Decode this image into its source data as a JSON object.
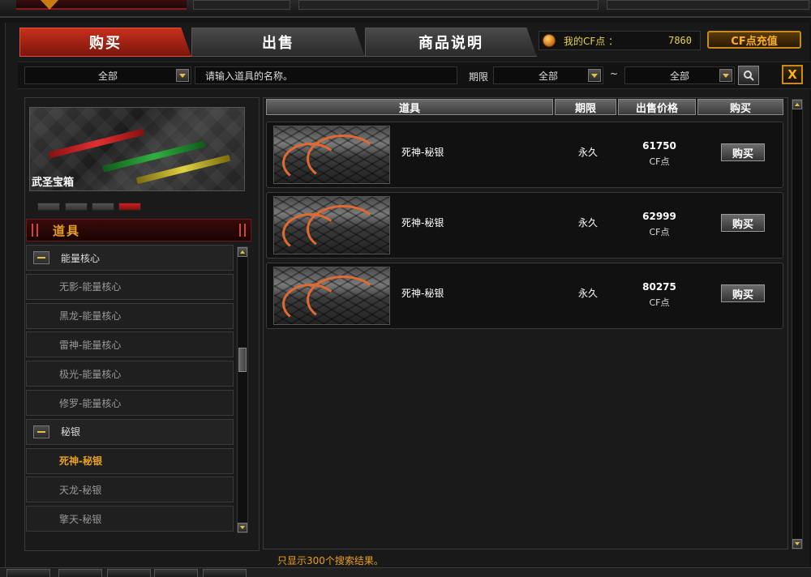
{
  "tabs": {
    "buy": "购买",
    "sell": "出售",
    "info": "商品说明"
  },
  "account": {
    "cf_label": "我的CF点 ：",
    "cf_value": "7860",
    "recharge_label": "CF点充值"
  },
  "filters": {
    "category_value": "全部",
    "search_placeholder": "请输入道具的名称。",
    "period_label": "期限",
    "period_from": "全部",
    "period_separator": "~",
    "period_to": "全部"
  },
  "close_label": "X",
  "banner": {
    "title": "武圣宝箱",
    "slide_count": 4,
    "active_slide": 4
  },
  "category": {
    "title": "道具",
    "items": [
      {
        "type": "group",
        "label": "能量核心"
      },
      {
        "type": "sub",
        "label": "无影-能量核心",
        "selected": false
      },
      {
        "type": "sub",
        "label": "黑龙-能量核心",
        "selected": false
      },
      {
        "type": "sub",
        "label": "雷神-能量核心",
        "selected": false
      },
      {
        "type": "sub",
        "label": "极光-能量核心",
        "selected": false
      },
      {
        "type": "sub",
        "label": "修罗-能量核心",
        "selected": false
      },
      {
        "type": "group",
        "label": "秘银"
      },
      {
        "type": "sub",
        "label": "死神-秘银",
        "selected": true
      },
      {
        "type": "sub",
        "label": "天龙-秘银",
        "selected": false
      },
      {
        "type": "sub",
        "label": "擎天-秘银",
        "selected": false
      }
    ]
  },
  "table": {
    "columns": [
      "道具",
      "期限",
      "出售价格",
      "购买"
    ],
    "rows": [
      {
        "name": "死神-秘银",
        "period": "永久",
        "price": "61750",
        "unit": "CF点",
        "buy": "购买"
      },
      {
        "name": "死神-秘银",
        "period": "永久",
        "price": "62999",
        "unit": "CF点",
        "buy": "购买"
      },
      {
        "name": "死神-秘银",
        "period": "永久",
        "price": "80275",
        "unit": "CF点",
        "buy": "购买"
      }
    ]
  },
  "footnote": "只显示300个搜索结果。",
  "colors": {
    "accent_red": "#c8301c",
    "gold": "#e8a020",
    "cf_yellow": "#e8d24a"
  }
}
